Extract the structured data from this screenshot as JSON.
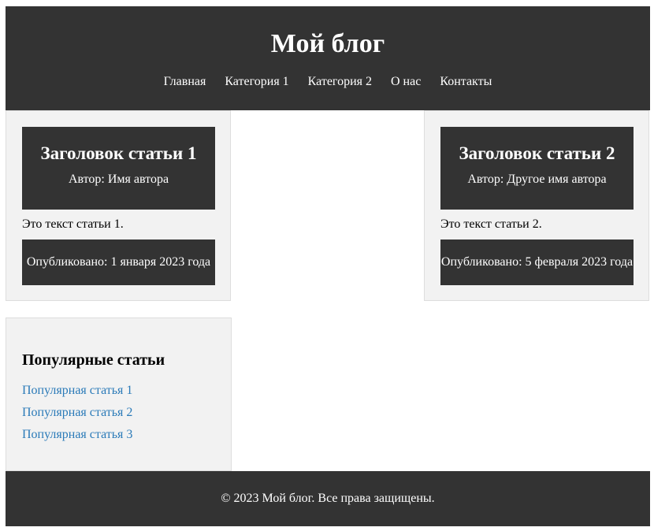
{
  "header": {
    "title": "Мой блог",
    "nav": [
      "Главная",
      "Категория 1",
      "Категория 2",
      "О нас",
      "Контакты"
    ]
  },
  "articles": [
    {
      "title": "Заголовок статьи 1",
      "author": "Автор: Имя автора",
      "body": "Это текст статьи 1.",
      "published": "Опубликовано: 1 января 2023 года"
    },
    {
      "title": "Заголовок статьи 2",
      "author": "Автор: Другое имя автора",
      "body": "Это текст статьи 2.",
      "published": "Опубликовано: 5 февраля 2023 года"
    }
  ],
  "sidebar": {
    "title": "Популярные статьи",
    "links": [
      "Популярная статья 1",
      "Популярная статья 2",
      "Популярная статья 3"
    ]
  },
  "footer": {
    "text": "© 2023 Мой блог. Все права защищены."
  },
  "colors": {
    "dark": "#333333",
    "panel": "#f2f2f2",
    "link": "#2a7ab8"
  }
}
